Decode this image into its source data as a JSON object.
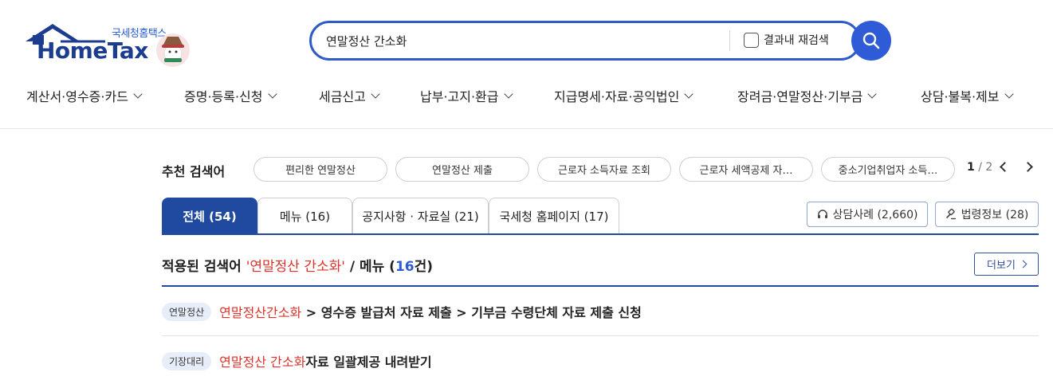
{
  "header": {
    "logo_kr": "국세청홈택스",
    "logo_en": "HomeTax",
    "search_value": "연말정산 간소화",
    "research_label": "결과내 재검색"
  },
  "gnb": [
    {
      "label": "계산서·영수증·카드"
    },
    {
      "label": "증명·등록·신청"
    },
    {
      "label": "세금신고"
    },
    {
      "label": "납부·고지·환급"
    },
    {
      "label": "지급명세·자료·공익법인"
    },
    {
      "label": "장려금·연말정산·기부금"
    },
    {
      "label": "상담·불복·제보"
    }
  ],
  "recommend": {
    "label": "추천 검색어",
    "chips": [
      "편리한 연말정산",
      "연말정산 제출",
      "근로자 소득자료 조회",
      "근로자 세액공제 자…",
      "중소기업취업자 소득…"
    ],
    "page_current": "1",
    "page_sep": " / ",
    "page_total": "2"
  },
  "tabs": [
    {
      "label": "전체 (54)"
    },
    {
      "label": "메뉴 (16)"
    },
    {
      "label": "공지사항 · 자료실 (21)"
    },
    {
      "label": "국세청 홈페이지 (17)"
    }
  ],
  "side_buttons": [
    {
      "label": "상담사례 (2,660)",
      "icon": "headset-icon"
    },
    {
      "label": "법령정보 (28)",
      "icon": "gavel-icon"
    }
  ],
  "results_header": {
    "prefix": "적용된 검색어 ",
    "keyword": "'연말정산 간소화'",
    "mid": " / 메뉴 (",
    "count": "16",
    "suffix": "건)",
    "more_label": "더보기"
  },
  "results": [
    {
      "badge": "연말정산",
      "highlight": "연말정산간소화",
      "rest": " > 영수증 발급처 자료 제출 > 기부금 수령단체 자료 제출 신청"
    },
    {
      "badge": "기장대리",
      "highlight": "연말정산 간소화",
      "rest": "자료 일괄제공 내려받기"
    }
  ],
  "colors": {
    "brand_blue": "#1f4aa0",
    "search_blue": "#2f5bd6",
    "highlight_red": "#d9342b"
  }
}
